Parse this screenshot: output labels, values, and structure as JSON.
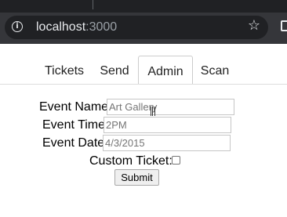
{
  "browser": {
    "url_host": "localhost",
    "url_port": ":3000",
    "icons": {
      "info": "info-icon",
      "bookmark": "star-icon",
      "extension": "extension-icon"
    }
  },
  "nav": {
    "tabs": [
      {
        "label": "Tickets",
        "active": false
      },
      {
        "label": "Send",
        "active": false
      },
      {
        "label": "Admin",
        "active": true
      },
      {
        "label": "Scan",
        "active": false
      }
    ]
  },
  "form": {
    "event_name_label": "Event Name:",
    "event_name_placeholder": "Art Gallery",
    "event_time_label": "Event Time:",
    "event_time_placeholder": "2PM",
    "event_date_label": "Event Date:",
    "event_date_placeholder": "4/3/2015",
    "custom_ticket_label": "Custom Ticket:",
    "custom_ticket_checked": false,
    "submit_label": "Submit"
  }
}
